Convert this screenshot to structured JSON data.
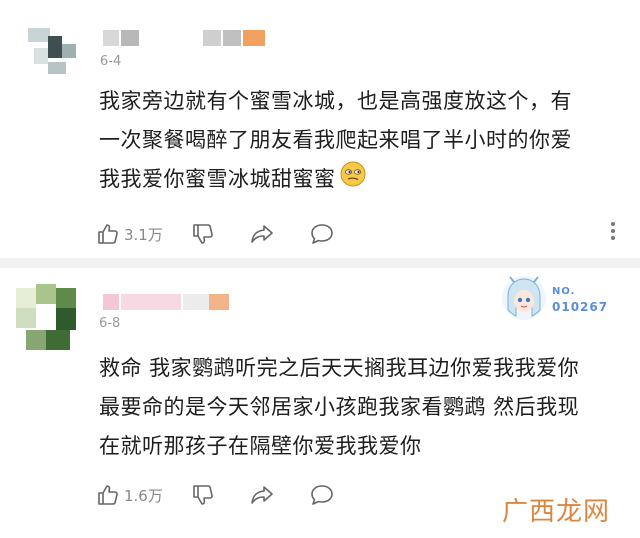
{
  "comments": [
    {
      "date": "6-4",
      "text_lines": [
        "我家旁边就有个蜜雪冰城，也是高强度放这个，有",
        "一次聚餐喝醉了朋友看我爬起来唱了半小时的你爱",
        "我我爱你蜜雪冰城甜蜜蜜"
      ],
      "emoji": "smirk-face-icon",
      "like_count": "3.1万"
    },
    {
      "date": "6-8",
      "text_lines": [
        "救命 我家鹦鹉听完之后天天搁我耳边你爱我我爱你",
        "最要命的是今天邻居家小孩跑我家看鹦鹉 然后我现",
        "在就听那孩子在隔壁你爱我我爱你"
      ],
      "like_count": "1.6万",
      "badge": {
        "label": "NO.",
        "number": "010267"
      }
    }
  ],
  "watermark": "广西龙网",
  "colors": {
    "badge_blue": "#5a8fd6",
    "watermark": "#d97a2a",
    "divider": "#f2f2f2",
    "meta_gray": "#999999"
  }
}
